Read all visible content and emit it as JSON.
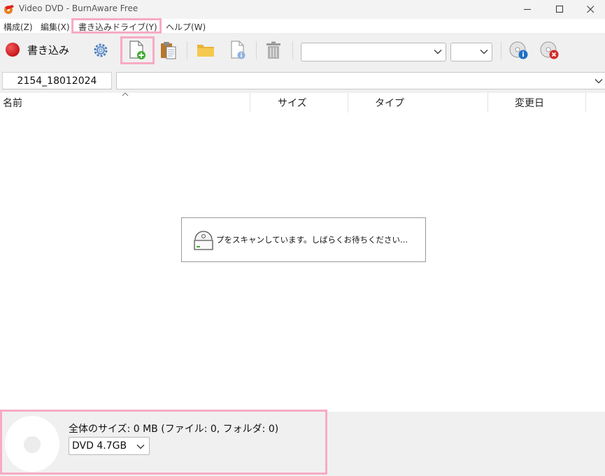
{
  "window": {
    "title": "Video DVD - BurnAware Free",
    "minimize_icon": "minimize-icon",
    "maximize_icon": "maximize-icon",
    "close_icon": "close-icon"
  },
  "menu": {
    "items": [
      {
        "label": "構成(Z)"
      },
      {
        "label": "編集(X)"
      },
      {
        "label": "書き込みドライブ(Y)"
      },
      {
        "label": "ヘルプ(W)"
      }
    ]
  },
  "toolbar": {
    "burn_label": "書き込み",
    "recorder_select_value": "",
    "speed_select_value": ""
  },
  "pathbar": {
    "folder_tab": "2154_18012024",
    "path_value": ""
  },
  "columns": {
    "name": "名前",
    "size": "サイズ",
    "type": "タイプ",
    "modified": "変更日"
  },
  "scan": {
    "message": "プをスキャンしています。しばらくお待ちください..."
  },
  "status": {
    "total_size": "全体のサイズ: 0 MB (ファイル: 0, フォルダ: 0)",
    "disc_type": "DVD 4.7GB"
  },
  "colors": {
    "highlight": "#f8aac5",
    "burn_red": "#c8161b",
    "add_green": "#3fae2f"
  }
}
